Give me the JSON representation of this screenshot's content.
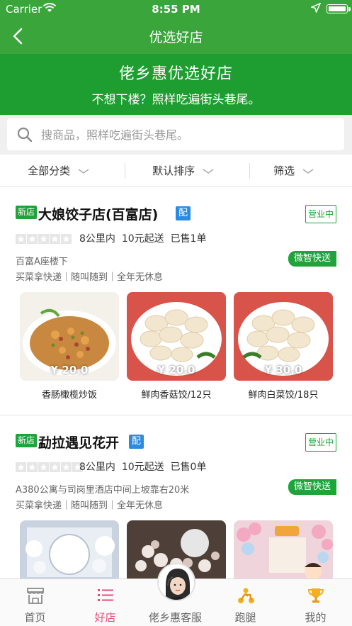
{
  "status_bar": {
    "carrier": "Carrier",
    "time": "8:55 PM"
  },
  "nav": {
    "title": "优选好店"
  },
  "banner": {
    "title": "佬乡惠优选好店",
    "subtitle": "不想下楼？照样吃遍街头巷尾。"
  },
  "search": {
    "placeholder": "搜商品，照样吃遍街头巷尾。"
  },
  "filters": [
    {
      "label": "全部分类"
    },
    {
      "label": "默认排序"
    },
    {
      "label": "筛选"
    }
  ],
  "shops": [
    {
      "new_tag": "新店",
      "name": "大娘饺子店(百富店)",
      "pei_tag": "配",
      "status": "营业中",
      "rating_stars": 0,
      "distance": "8公里内",
      "min_order": "10元起送",
      "sold": "已售1单",
      "address": "百富A座楼下",
      "delivery_tag": "微智快送",
      "services": "买菜拿快递｜随叫随到｜全年无休息",
      "products": [
        {
          "price": "¥ 20.0",
          "name": "香肠橄榄炒饭"
        },
        {
          "price": "¥ 20.0",
          "name": "鲜肉香菇饺/12只"
        },
        {
          "price": "¥ 30.0",
          "name": "鲜肉白菜饺/18只"
        }
      ]
    },
    {
      "new_tag": "新店",
      "name": "勐拉遇见花开",
      "pei_tag": "配",
      "status": "营业中",
      "rating_stars": 0,
      "distance": "8公里内",
      "min_order": "10元起送",
      "sold": "已售0单",
      "address": "A380公寓与司岗里酒店中间上坡靠右20米",
      "delivery_tag": "微智快送",
      "services": "买菜拿快递｜随叫随到｜全年无休息",
      "products": []
    }
  ],
  "tab_bar": [
    {
      "label": "首页",
      "icon": "shop-icon"
    },
    {
      "label": "好店",
      "icon": "list-icon",
      "active": true
    },
    {
      "label": "佬乡惠客服",
      "icon": "avatar-icon"
    },
    {
      "label": "跑腿",
      "icon": "scooter-icon"
    },
    {
      "label": "我的",
      "icon": "trophy-icon"
    }
  ],
  "colors": {
    "primary_green": "#3aa53a",
    "banner_green": "#1e9e31",
    "badge_green": "#1fa33a",
    "pei_blue": "#2a8be0",
    "active_pink": "#e94c77"
  }
}
